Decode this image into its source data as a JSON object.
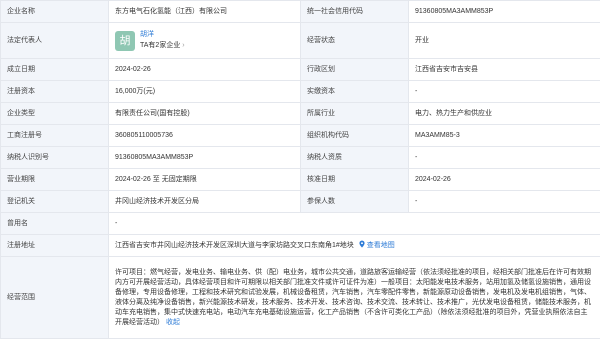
{
  "rows": {
    "company_name": {
      "label": "企业名称",
      "value": "东方电气石化氢能（江西）有限公司"
    },
    "credit_code": {
      "label": "统一社会信用代码",
      "value": "91360805MA3AMM853P"
    },
    "legal_rep": {
      "label": "法定代表人",
      "avatar_char": "胡",
      "name": "胡洋",
      "companies_text": "TA有2家企业",
      "arrow": "›"
    },
    "status": {
      "label": "经营状态",
      "value": "开业"
    },
    "established": {
      "label": "成立日期",
      "value": "2024-02-26"
    },
    "region": {
      "label": "行政区划",
      "value": "江西省吉安市吉安县"
    },
    "reg_capital": {
      "label": "注册资本",
      "value": "16,000万(元)"
    },
    "paid_capital": {
      "label": "实缴资本",
      "value": "-"
    },
    "company_type": {
      "label": "企业类型",
      "value": "有限责任公司(国有控股)"
    },
    "industry": {
      "label": "所属行业",
      "value": "电力、热力生产和供应业"
    },
    "reg_number": {
      "label": "工商注册号",
      "value": "360805110005736"
    },
    "org_code": {
      "label": "组织机构代码",
      "value": "MA3AMM85-3"
    },
    "taxpayer_id": {
      "label": "纳税人识别号",
      "value": "91360805MA3AMM853P"
    },
    "taxpayer_qual": {
      "label": "纳税人资质",
      "value": "-"
    },
    "term": {
      "label": "营业期限",
      "value": "2024-02-26 至 无固定期限"
    },
    "approval_date": {
      "label": "核准日期",
      "value": "2024-02-26"
    },
    "authority": {
      "label": "登记机关",
      "value": "井冈山经济技术开发区分局"
    },
    "insured": {
      "label": "参保人数",
      "value": "-"
    },
    "former_name": {
      "label": "曾用名",
      "value": "-"
    },
    "address": {
      "label": "注册地址",
      "value": "江西省吉安市井冈山经济技术开发区深圳大道与李家坊路交叉口东南角1#地块",
      "map_link": "查看地图"
    },
    "scope": {
      "label": "经营范围",
      "value": "许可项目：燃气经营，发电业务、输电业务、供（配）电业务，城市公共交通，道路旅客运输经营（依法须经批准的项目，经相关部门批准后在许可有效期内方可开展经营活动，具体经营项目和许可期限以相关部门批准文件或许可证件为准）一般项目：太阳能发电技术服务，站用加氢及储氢设施销售，通用设备修理，专用设备修理，工程和技术研究和试验发展，机械设备租赁，汽车销售，汽车零配件零售，新能源原动设备销售，发电机及发电机组销售，气体、液体分离及纯净设备销售，新兴能源技术研发，技术服务、技术开发、技术咨询、技术交流、技术转让、技术推广，光伏发电设备租赁，储能技术服务，机动车充电销售，集中式快速充电站，电动汽车充电基础设施运营，化工产品销售（不含许可类化工产品）（除依法须经批准的项目外，凭营业执照依法自主开展经营活动）",
      "collapse_link": "收起"
    }
  },
  "colors": {
    "label_bg": "#f2f5fa",
    "border": "#e4e7ed",
    "link": "#2d7bd6",
    "avatar_bg": "#8fc7b3"
  },
  "icons": {
    "map": "map-pin-icon"
  }
}
